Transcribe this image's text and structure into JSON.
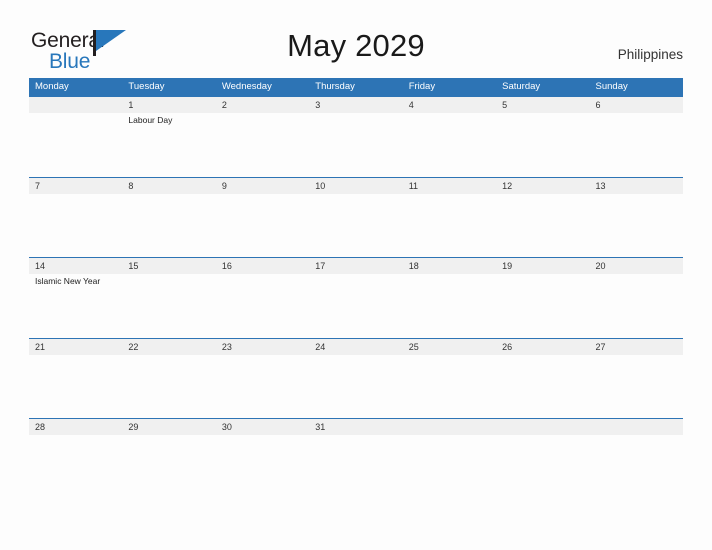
{
  "brand": {
    "name_primary": "General",
    "name_secondary": "Blue",
    "flag_icon": "blue-flag-triangle-icon"
  },
  "header": {
    "title": "May 2029",
    "region": "Philippines"
  },
  "colors": {
    "header_blue": "#2d74b5",
    "brand_blue": "#2877bb",
    "daynum_band": "#f0f0f0",
    "page_background": "#fdfdfd",
    "text": "#222222"
  },
  "calendar": {
    "weekdays": [
      "Monday",
      "Tuesday",
      "Wednesday",
      "Thursday",
      "Friday",
      "Saturday",
      "Sunday"
    ],
    "weeks": [
      {
        "days": [
          {
            "num": "",
            "event": ""
          },
          {
            "num": "1",
            "event": "Labour Day"
          },
          {
            "num": "2",
            "event": ""
          },
          {
            "num": "3",
            "event": ""
          },
          {
            "num": "4",
            "event": ""
          },
          {
            "num": "5",
            "event": ""
          },
          {
            "num": "6",
            "event": ""
          }
        ]
      },
      {
        "days": [
          {
            "num": "7",
            "event": ""
          },
          {
            "num": "8",
            "event": ""
          },
          {
            "num": "9",
            "event": ""
          },
          {
            "num": "10",
            "event": ""
          },
          {
            "num": "11",
            "event": ""
          },
          {
            "num": "12",
            "event": ""
          },
          {
            "num": "13",
            "event": ""
          }
        ]
      },
      {
        "days": [
          {
            "num": "14",
            "event": "Islamic New Year"
          },
          {
            "num": "15",
            "event": ""
          },
          {
            "num": "16",
            "event": ""
          },
          {
            "num": "17",
            "event": ""
          },
          {
            "num": "18",
            "event": ""
          },
          {
            "num": "19",
            "event": ""
          },
          {
            "num": "20",
            "event": ""
          }
        ]
      },
      {
        "days": [
          {
            "num": "21",
            "event": ""
          },
          {
            "num": "22",
            "event": ""
          },
          {
            "num": "23",
            "event": ""
          },
          {
            "num": "24",
            "event": ""
          },
          {
            "num": "25",
            "event": ""
          },
          {
            "num": "26",
            "event": ""
          },
          {
            "num": "27",
            "event": ""
          }
        ]
      },
      {
        "days": [
          {
            "num": "28",
            "event": ""
          },
          {
            "num": "29",
            "event": ""
          },
          {
            "num": "30",
            "event": ""
          },
          {
            "num": "31",
            "event": ""
          },
          {
            "num": "",
            "event": ""
          },
          {
            "num": "",
            "event": ""
          },
          {
            "num": "",
            "event": ""
          }
        ]
      }
    ]
  }
}
